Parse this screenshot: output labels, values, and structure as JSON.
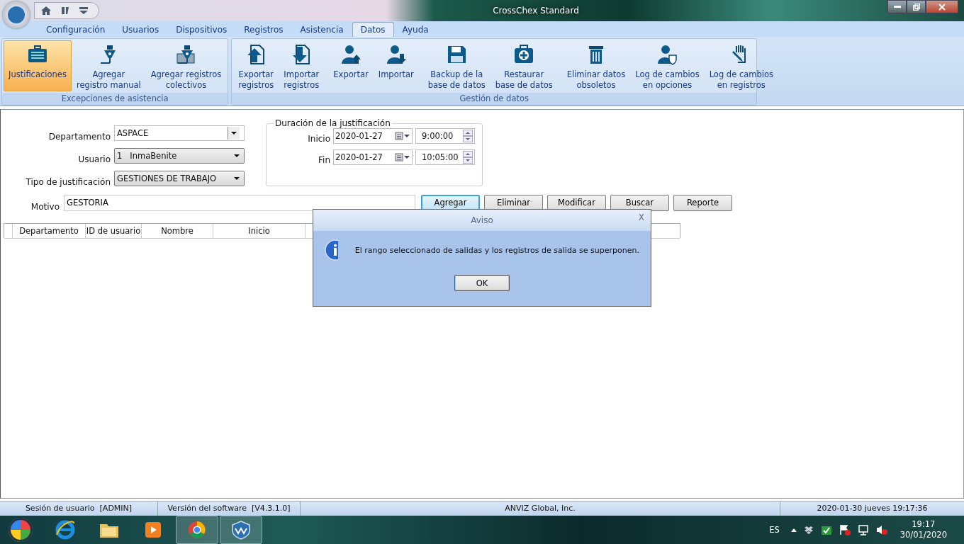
{
  "window": {
    "title": "CrossChex Standard"
  },
  "menu_tabs": [
    {
      "label": "Configuración",
      "selected": false
    },
    {
      "label": "Usuarios",
      "selected": false
    },
    {
      "label": "Dispositivos",
      "selected": false
    },
    {
      "label": "Registros",
      "selected": false
    },
    {
      "label": "Asistencia",
      "selected": false
    },
    {
      "label": "Datos",
      "selected": true
    },
    {
      "label": "Ayuda",
      "selected": false
    }
  ],
  "ribbon_groups": [
    {
      "label": "Excepciones de asistencia",
      "sections": [
        [
          {
            "label": "Justificaciones",
            "selected": true
          },
          {
            "label": "Agregar\nregistro manual",
            "selected": false
          },
          {
            "label": "Agregar registros\ncolectivos",
            "selected": false
          }
        ]
      ]
    },
    {
      "label": "Gestión de datos",
      "sections": [
        [
          {
            "label": "Exportar\nregistros",
            "selected": false
          },
          {
            "label": "Importar\nregistros",
            "selected": false
          }
        ],
        [
          {
            "label": "Exportar",
            "selected": false
          },
          {
            "label": "Importar",
            "selected": false
          }
        ],
        [
          {
            "label": "Backup de la\nbase de datos",
            "selected": false
          },
          {
            "label": "Restaurar\nbase de datos",
            "selected": false
          }
        ],
        [
          {
            "label": "Eliminar datos\nobsoletos",
            "selected": false
          },
          {
            "label": "Log de cambios\nen opciones",
            "selected": false
          },
          {
            "label": "Log de cambios\nen registros",
            "selected": false
          }
        ]
      ]
    }
  ],
  "form": {
    "departamento": {
      "label": "Departamento",
      "value": "ASPACE"
    },
    "usuario": {
      "label": "Usuario",
      "value": "1   InmaBenite"
    },
    "tipo": {
      "label": "Tipo de justificación",
      "value": "GESTIONES DE TRABAJO"
    },
    "motivo": {
      "label": "Motivo",
      "value": "GESTORIA"
    },
    "duracion": {
      "title": "Duración de la justificación",
      "rows": [
        {
          "label": "Inicio",
          "date": "2020-01-27",
          "time": "9:00:00"
        },
        {
          "label": "Fin",
          "date": "2020-01-27",
          "time": "10:05:00"
        }
      ]
    },
    "buttons": [
      {
        "label": "Agregar",
        "focused": true
      },
      {
        "label": "Eliminar",
        "focused": false
      },
      {
        "label": "Modificar",
        "focused": false
      },
      {
        "label": "Buscar",
        "focused": false
      },
      {
        "label": "Reporte",
        "focused": false
      }
    ]
  },
  "table": {
    "columns": [
      "Departamento",
      "ID de usuario",
      "Nombre",
      "Inicio"
    ]
  },
  "dialog": {
    "title": "Aviso",
    "close": "X",
    "message": "El rango seleccionado de salidas y los registros de salida se superponen.",
    "button": "OK"
  },
  "status_bar": [
    "Sesión de usuario  [ADMIN]",
    "Versión del software  [V4.3.1.0]",
    "ANVIZ Global, Inc.",
    "2020-01-30 jueves 19:17:36"
  ],
  "taskbar": {
    "apps": [
      {
        "running": false
      },
      {
        "running": false
      },
      {
        "running": false
      },
      {
        "running": true
      },
      {
        "running": true
      }
    ],
    "language": "ES",
    "time": "19:17",
    "date": "30/01/2020"
  }
}
